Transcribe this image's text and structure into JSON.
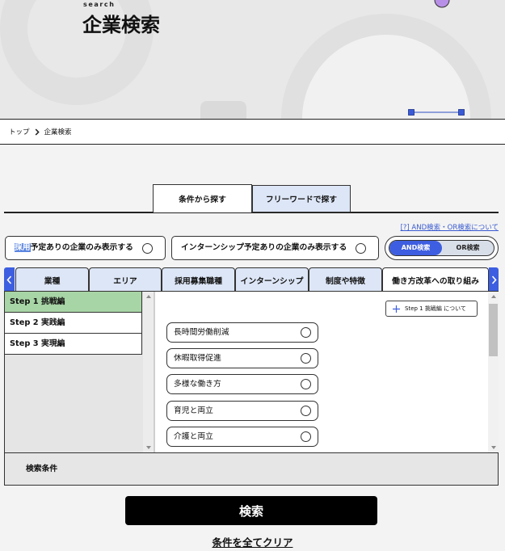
{
  "hero": {
    "eyebrow": "search",
    "title": "企業検索"
  },
  "breadcrumb": {
    "home": "トップ",
    "current": "企業検索",
    "separator_icon": "chevron-right-icon"
  },
  "search_tabs": [
    {
      "label": "条件から探す",
      "active": true
    },
    {
      "label": "フリーワードで探す",
      "active": false
    }
  ],
  "help_link": "[?] AND検索・OR検索について",
  "filters": {
    "recruit_only": {
      "highlight": "採用",
      "rest": "予定ありの企業のみ表示する",
      "checked": false
    },
    "intern_only": {
      "label": "インターンシップ予定ありの企業のみ表示する",
      "checked": false
    },
    "mode": {
      "and_label": "AND検索",
      "or_label": "OR検索",
      "and_active": true
    }
  },
  "category_tabs": [
    {
      "label": "業種",
      "active": false
    },
    {
      "label": "エリア",
      "active": false
    },
    {
      "label": "採用募集職種",
      "active": false
    },
    {
      "label": "インターンシップ",
      "active": false
    },
    {
      "label": "制度や特徴",
      "active": false
    },
    {
      "label": "働き方改革への取り組み",
      "active": true
    }
  ],
  "steps": [
    {
      "label": "Step 1 挑戦編",
      "active": true
    },
    {
      "label": "Step 2 実践編",
      "active": false
    },
    {
      "label": "Step 3 実現編",
      "active": false
    }
  ],
  "about_button": "Step 1 挑戦編 について",
  "options": [
    {
      "label": "長時間労働削減",
      "checked": false
    },
    {
      "label": "休暇取得促進",
      "checked": false
    },
    {
      "label": "多様な働き方",
      "checked": false
    },
    {
      "label": "育児と両立",
      "checked": false
    },
    {
      "label": "介護と両立",
      "checked": false
    }
  ],
  "conditions_label": "検索条件",
  "search_button": "検索",
  "clear_link": "条件を全てクリア",
  "colors": {
    "accent": "#3d5ee0",
    "tab_bg": "#dde6f6",
    "step_active": "#a8d5a6",
    "link": "#3a5bd0"
  }
}
